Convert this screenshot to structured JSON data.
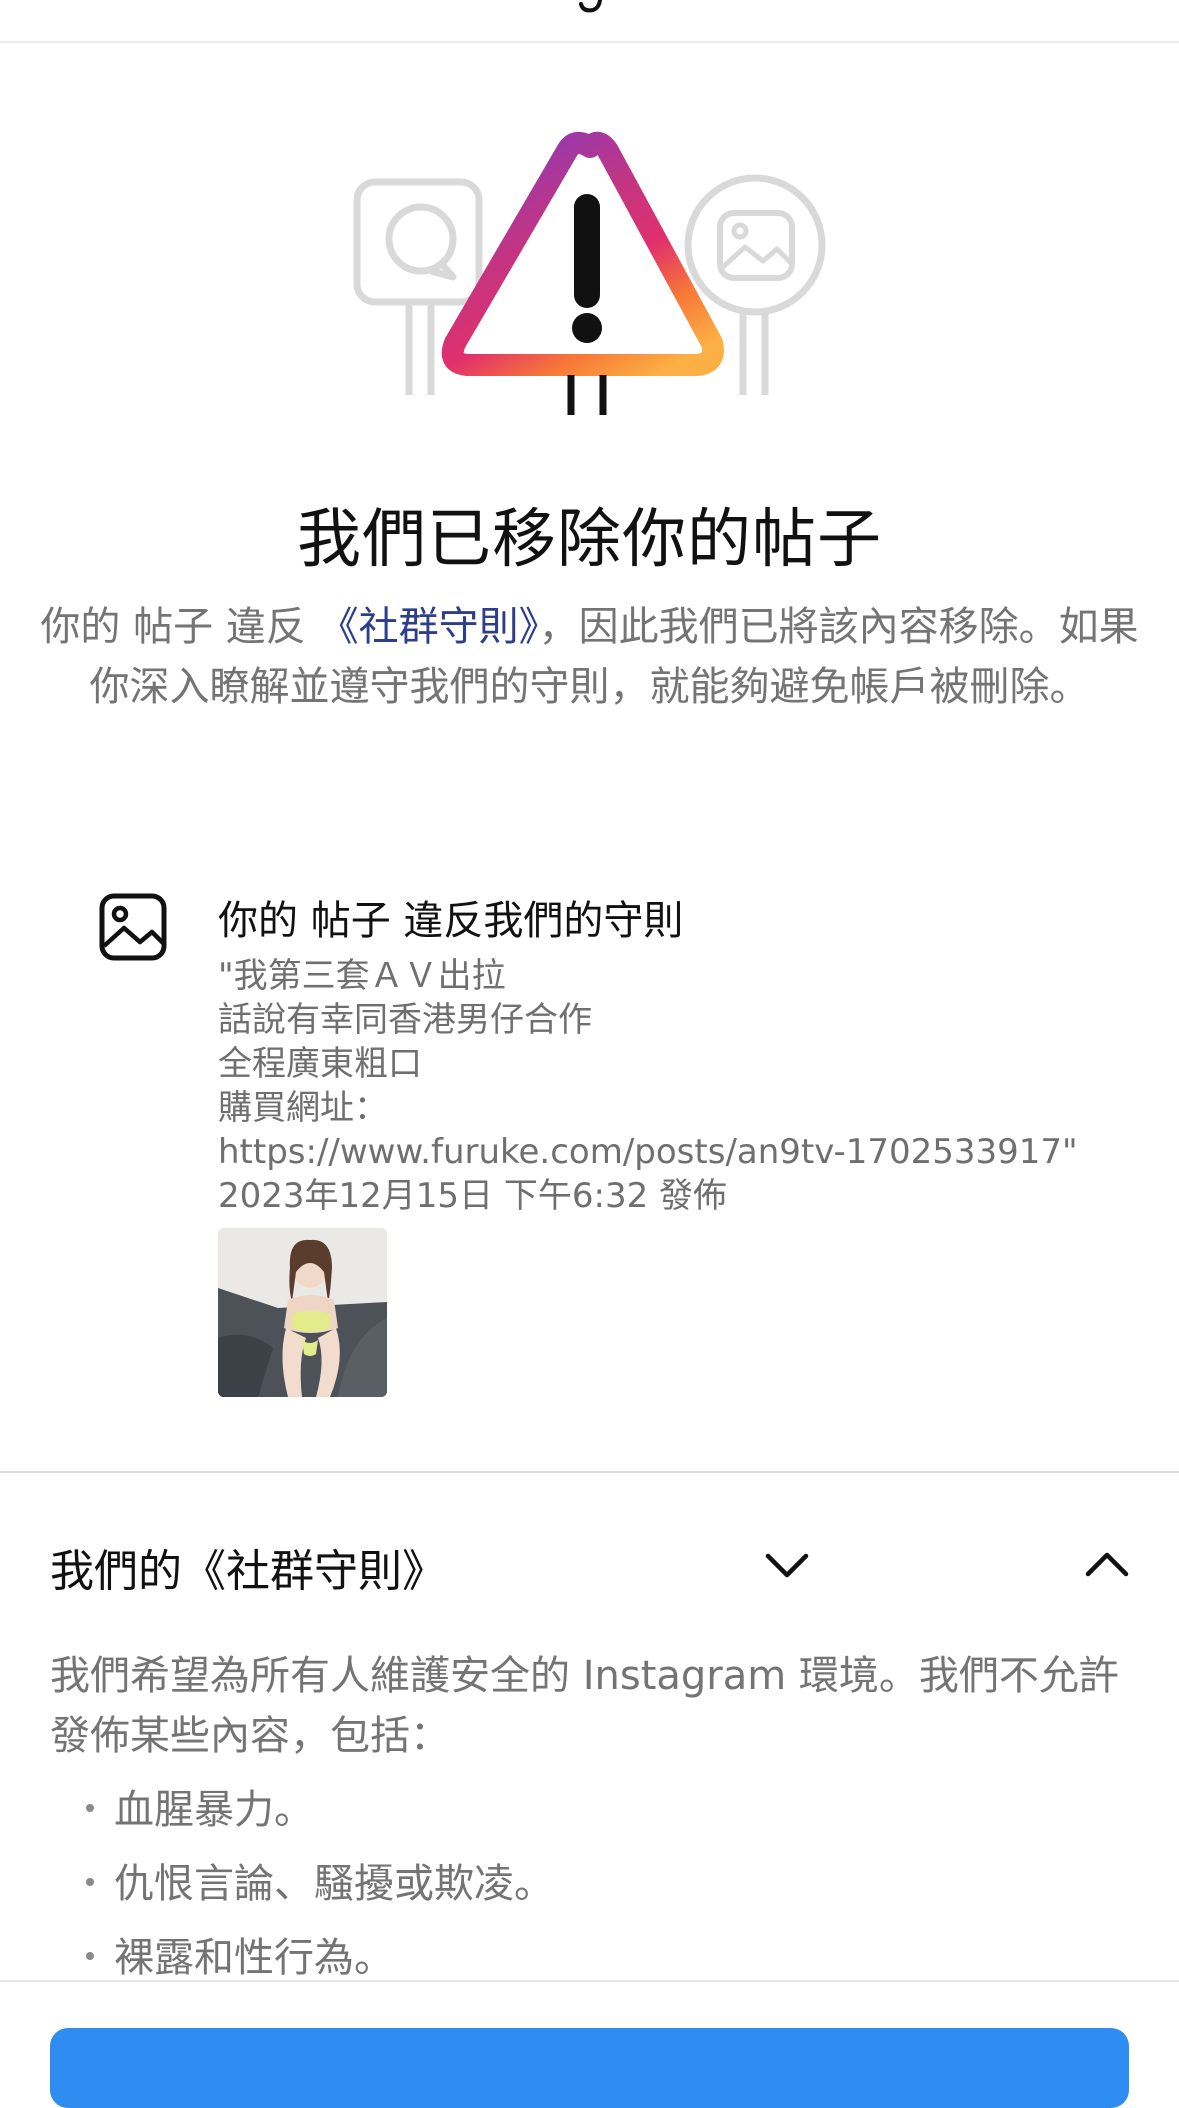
{
  "header": {
    "logo_text": "Instagram"
  },
  "notice": {
    "title": "我們已移除你的帖子",
    "description_before": "你的 帖子 違反 ",
    "description_link": "《社群守則》",
    "description_after": "，因此我們已將該內容移除。如果你深入瞭解並遵守我們的守則，就能夠避免帳戶被刪除。"
  },
  "post": {
    "heading": "你的 帖子 違反我們的守則",
    "caption_lines": [
      "\"我第三套ＡＶ出拉",
      "話說有幸同香港男仔合作",
      "全程廣東粗口",
      "購買網址：",
      "https://www.furuke.com/posts/an9tv-1702533917\""
    ],
    "posted_at": "2023年12月15日 下午6:32 發佈"
  },
  "guidelines": {
    "section_title": "我們的《社群守則》",
    "intro": "我們希望為所有人維護安全的 Instagram 環境。我們不允許發佈某些內容，包括：",
    "items": [
      "血腥暴力。",
      "仇恨言論、騷擾或欺凌。",
      "裸露和性行為。"
    ]
  },
  "colors": {
    "link": "#2d3e8a",
    "muted_text": "#747474",
    "primary_button": "#2f8cf0",
    "gradient_warning": [
      "#8a3ab9",
      "#e1306c",
      "#fd1d1d",
      "#f77737",
      "#fcaf45"
    ]
  },
  "icons": {
    "hero": "warning-triangle-icon",
    "chat_board": "chat-bubble-icon",
    "image_board": "image-icon",
    "post_type": "image-icon",
    "collapse": "chevron-down-icon",
    "expand": "chevron-up-icon"
  }
}
